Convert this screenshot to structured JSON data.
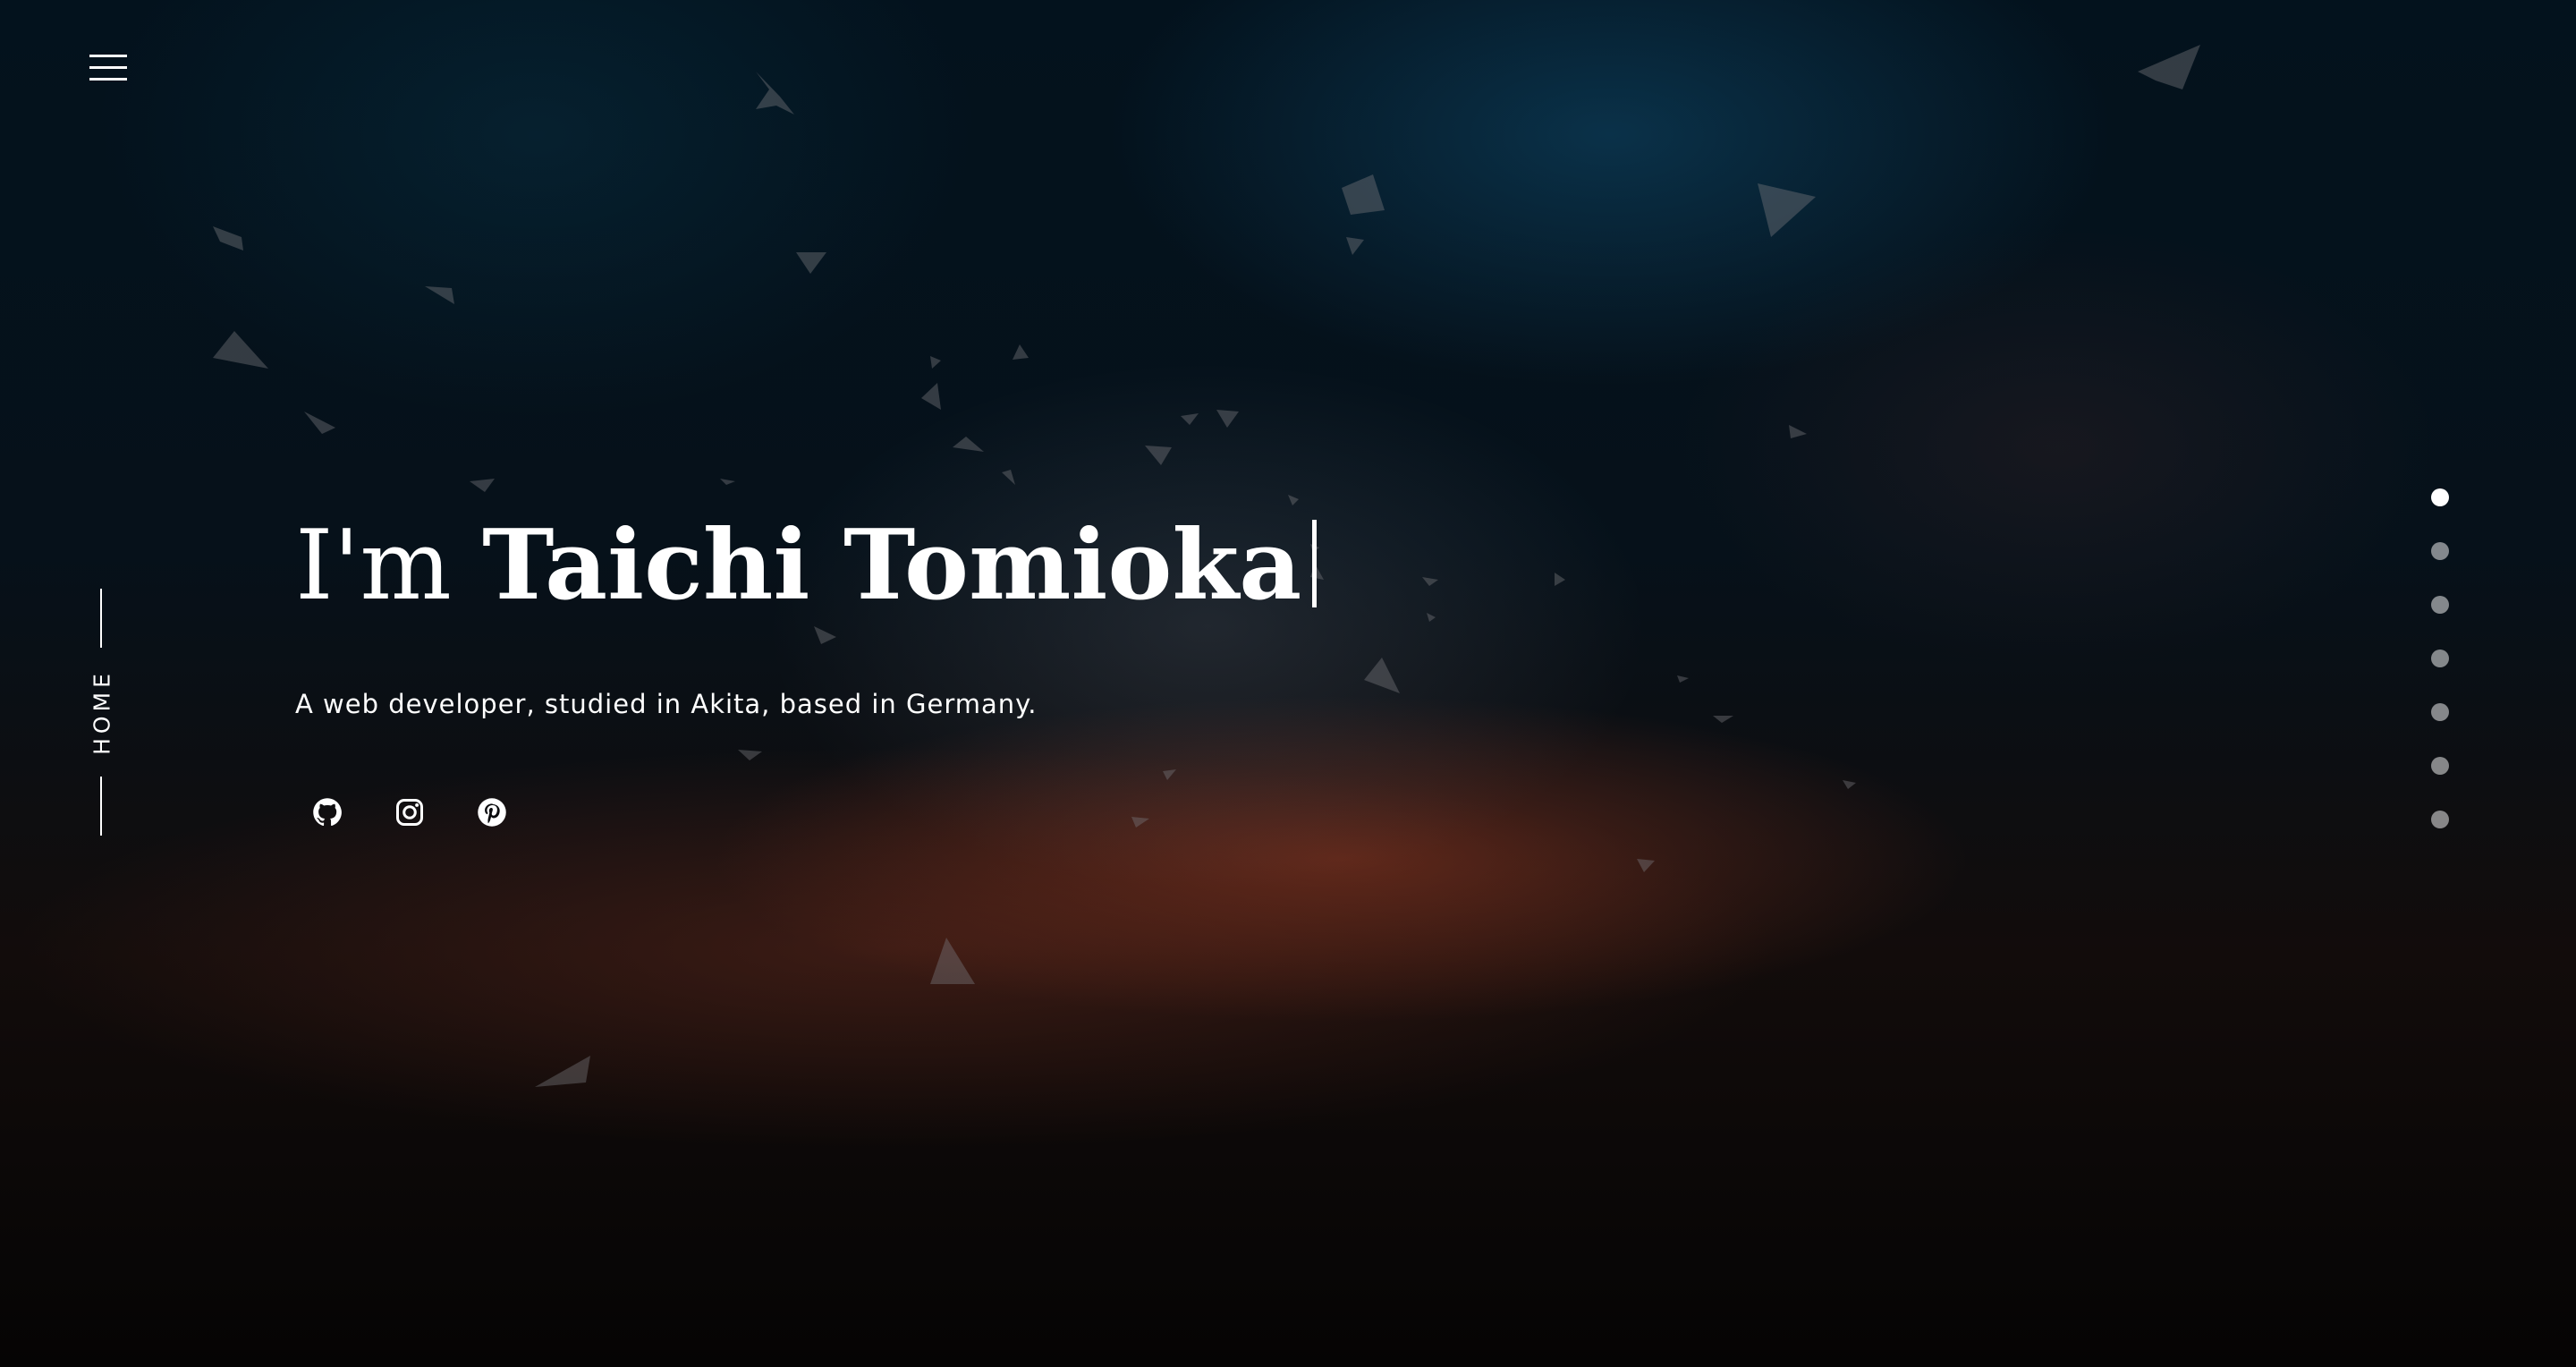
{
  "menu": {
    "icon": "hamburger-menu-icon"
  },
  "section_indicator": {
    "label": "HOME"
  },
  "hero": {
    "greeting": "I'm",
    "name": "Taichi Tomioka",
    "subtitle": "A web developer, studied in Akita, based in Germany."
  },
  "social_links": [
    {
      "icon": "github-icon"
    },
    {
      "icon": "instagram-icon"
    },
    {
      "icon": "pinterest-icon"
    }
  ],
  "section_dots": {
    "count": 7,
    "active_index": 0
  },
  "colors": {
    "text": "#ffffff",
    "background": "#05080c",
    "glow_orange": "#963a22",
    "glow_blue": "#0f4b6e"
  }
}
